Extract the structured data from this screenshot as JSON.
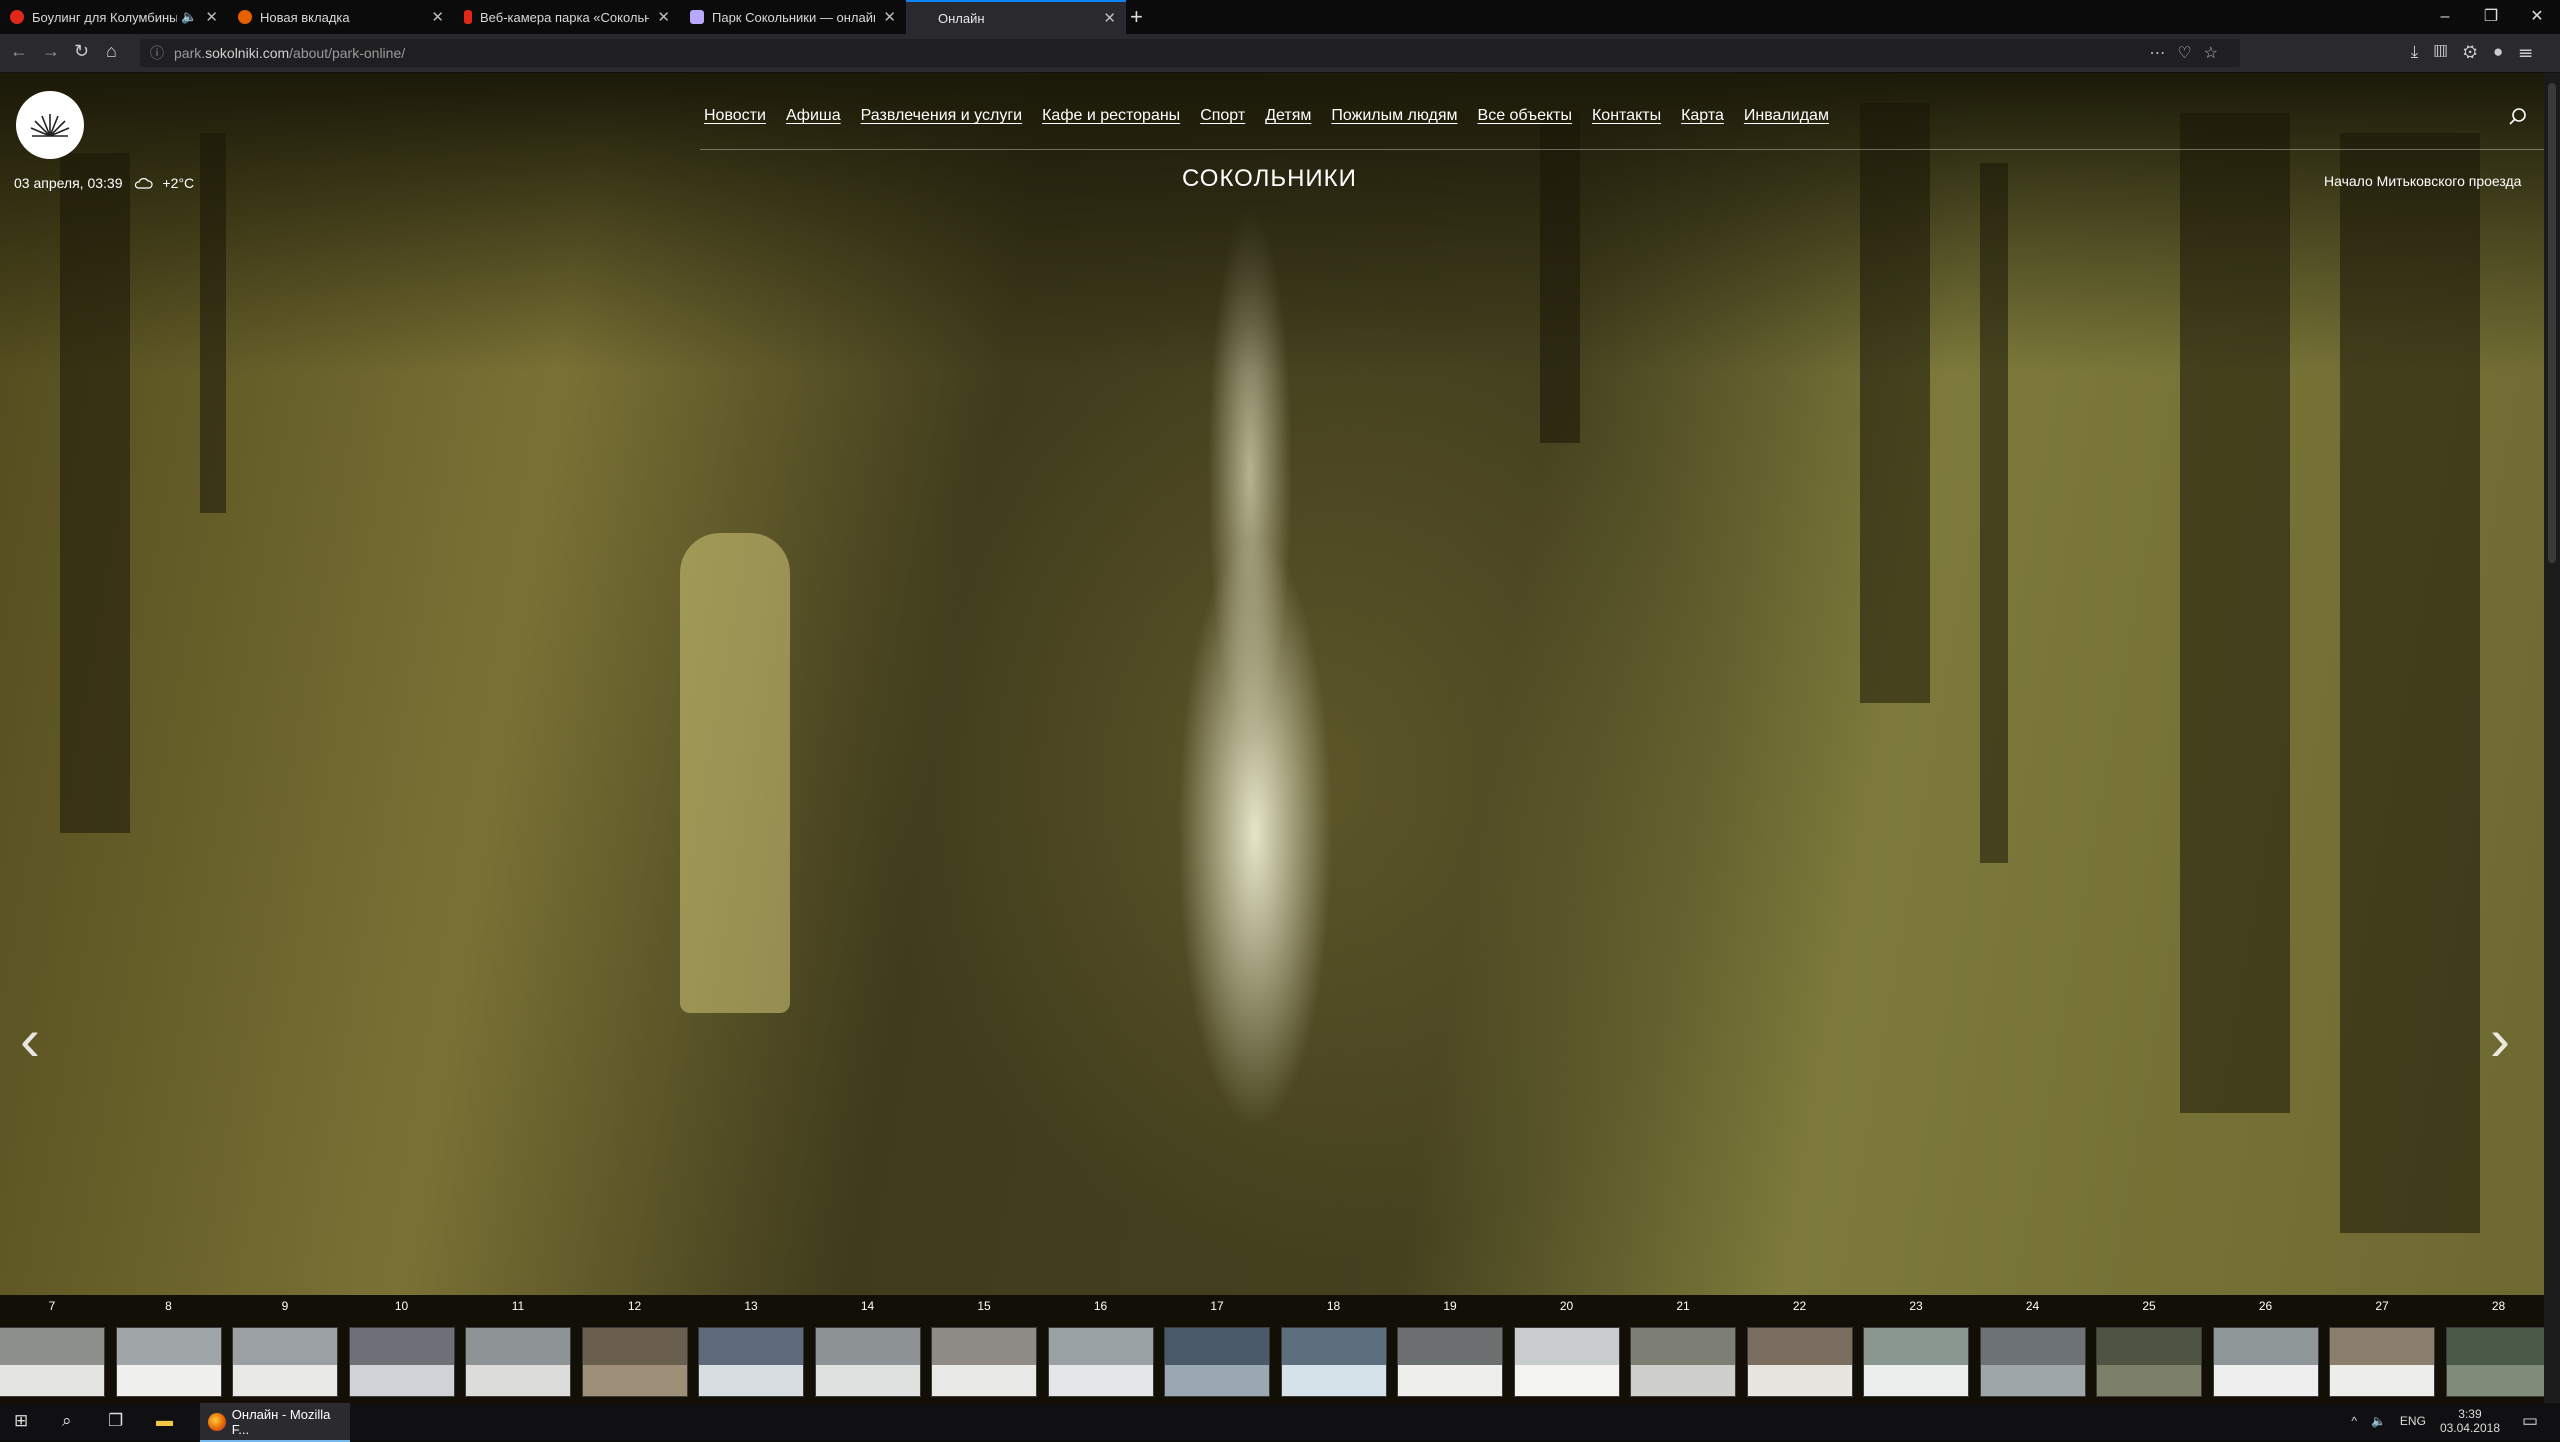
{
  "browser": {
    "tabs": [
      {
        "title": "Боулинг для Колумбины",
        "favicon_color": "#e0271a",
        "audio": true
      },
      {
        "title": "Новая вкладка",
        "favicon_color": "#e66000"
      },
      {
        "title": "Веб-камера парка «Сокольн",
        "favicon_color": "#e0271a"
      },
      {
        "title": "Парк Сокольники — онлайн",
        "favicon_color": "#b8a8ff"
      },
      {
        "title": "Онлайн",
        "favicon_color": "#2a2a2e"
      }
    ],
    "new_tab": "+",
    "window_controls": [
      "–",
      "❐",
      "✕"
    ],
    "url_prefix": "park.",
    "url_host": "sokolniki.com",
    "url_path": "/about/park-online/"
  },
  "site": {
    "nav": [
      "Новости",
      "Афиша",
      "Развлечения и услуги",
      "Кафе и рестораны",
      "Спорт",
      "Детям",
      "Пожилым людям",
      "Все объекты",
      "Контакты",
      "Карта",
      "Инвалидам"
    ],
    "datetime": "03 апреля, 03:39",
    "weather": "+2°C",
    "title": "СОКОЛЬНИКИ",
    "camera_name": "Начало Митьковского проезда",
    "prev_arrow": "‹",
    "next_arrow": "›",
    "thumbnails": [
      "7",
      "8",
      "9",
      "10",
      "11",
      "12",
      "13",
      "14",
      "15",
      "16",
      "17",
      "18",
      "19",
      "20",
      "21",
      "22",
      "23",
      "24",
      "25",
      "26",
      "27",
      "28"
    ]
  },
  "taskbar": {
    "app_label": "Онлайн - Mozilla F...",
    "lang": "ENG",
    "time": "3:39",
    "date": "03.04.2018"
  }
}
